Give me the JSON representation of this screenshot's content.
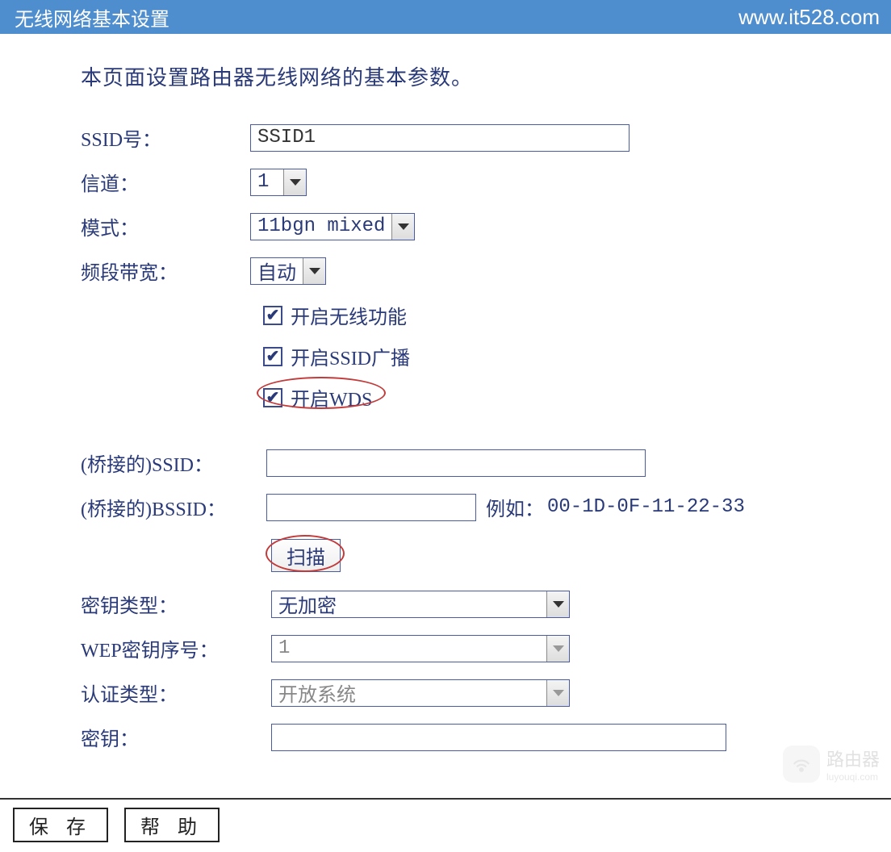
{
  "header": {
    "title": "无线网络基本设置",
    "url": "www.it528.com"
  },
  "description": "本页面设置路由器无线网络的基本参数。",
  "fields": {
    "ssid_label": "SSID号：",
    "ssid_value": "SSID1",
    "channel_label": "信道：",
    "channel_value": "1",
    "mode_label": "模式：",
    "mode_value": "11bgn mixed",
    "bandwidth_label": "频段带宽：",
    "bandwidth_value": "自动"
  },
  "checkboxes": {
    "enable_wireless": "开启无线功能",
    "enable_ssid_broadcast": "开启SSID广播",
    "enable_wds": "开启WDS"
  },
  "bridge": {
    "ssid_label": "(桥接的)SSID：",
    "ssid_value": "",
    "bssid_label": "(桥接的)BSSID：",
    "bssid_value": "",
    "bssid_hint_label": "例如：",
    "bssid_hint_example": "00-1D-0F-11-22-33",
    "scan_button": "扫描",
    "key_type_label": "密钥类型：",
    "key_type_value": "无加密",
    "wep_index_label": "WEP密钥序号：",
    "wep_index_value": "1",
    "auth_type_label": "认证类型：",
    "auth_type_value": "开放系统",
    "key_label": "密钥：",
    "key_value": ""
  },
  "footer": {
    "save": "保 存",
    "help": "帮 助"
  },
  "watermark": {
    "text": "路由器",
    "url": "luyouqi.com"
  }
}
